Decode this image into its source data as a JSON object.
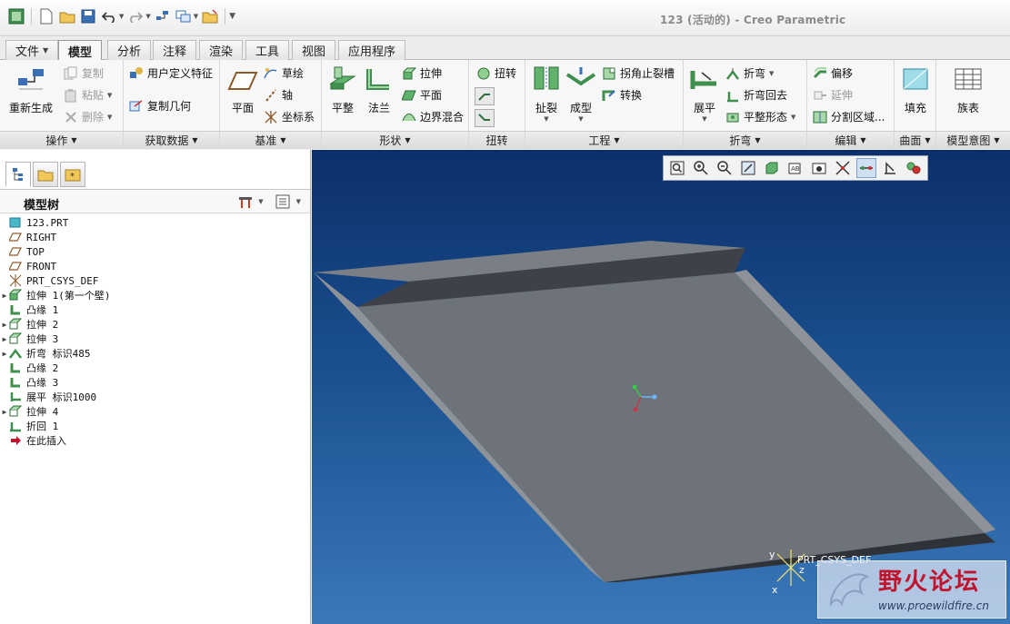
{
  "window": {
    "title": "123 (活动的) - Creo Parametric"
  },
  "quick_access": [
    {
      "name": "app-logo-icon"
    },
    {
      "name": "new-file-icon"
    },
    {
      "name": "open-folder-icon"
    },
    {
      "name": "save-icon"
    },
    {
      "name": "undo-icon"
    },
    {
      "name": "redo-icon"
    },
    {
      "name": "regenerate-icon"
    },
    {
      "name": "windows-icon"
    },
    {
      "name": "close-window-icon"
    }
  ],
  "tabs": [
    {
      "label": "文件",
      "has_menu": true
    },
    {
      "label": "模型",
      "active": true
    },
    {
      "label": "分析"
    },
    {
      "label": "注释"
    },
    {
      "label": "渲染"
    },
    {
      "label": "工具"
    },
    {
      "label": "视图"
    },
    {
      "label": "应用程序"
    }
  ],
  "ribbon": {
    "operations": {
      "group_label": "操作",
      "regenerate": "重新生成",
      "copy": "复制",
      "paste": "粘贴",
      "delete": "删除"
    },
    "get_data": {
      "group_label": "获取数据",
      "user_defined_feature": "用户定义特征",
      "copy_geometry": "复制几何"
    },
    "datum": {
      "group_label": "基准",
      "plane": "平面",
      "sketch": "草绘",
      "axis": "轴",
      "csys": "坐标系"
    },
    "shapes": {
      "group_label": "形状",
      "flat": "平整",
      "flange": "法兰",
      "extrude": "拉伸",
      "planar": "平面",
      "boundary_blend": "边界混合"
    },
    "twist": {
      "group_label": "扭转",
      "twist": "扭转"
    },
    "engineering": {
      "group_label": "工程",
      "rip": "扯裂",
      "form": "成型",
      "corner_relief": "拐角止裂槽",
      "convert": "转换"
    },
    "bends": {
      "group_label": "折弯",
      "unbend": "展平",
      "bend": "折弯",
      "bend_back": "折弯回去",
      "flatten_form": "平整形态"
    },
    "editing": {
      "group_label": "编辑",
      "offset": "偏移",
      "extend": "延伸",
      "split_area": "分割区域..."
    },
    "surfaces": {
      "group_label": "曲面",
      "fill": "填充"
    },
    "model_intent": {
      "group_label": "模型意图",
      "family_table": "族表"
    }
  },
  "left_panel": {
    "tree_title": "模型树",
    "tree": [
      {
        "label": "123.PRT",
        "icon": "part-icon",
        "expandable": false
      },
      {
        "label": "RIGHT",
        "icon": "datum-plane-icon",
        "expandable": false
      },
      {
        "label": "TOP",
        "icon": "datum-plane-icon",
        "expandable": false
      },
      {
        "label": "FRONT",
        "icon": "datum-plane-icon",
        "expandable": false
      },
      {
        "label": "PRT_CSYS_DEF",
        "icon": "csys-icon",
        "expandable": false
      },
      {
        "label": "拉伸 1(第一个壁)",
        "icon": "extrude-icon",
        "expandable": true
      },
      {
        "label": "凸缘 1",
        "icon": "flange-icon",
        "expandable": false
      },
      {
        "label": "拉伸 2",
        "icon": "extrude-cut-icon",
        "expandable": true
      },
      {
        "label": "拉伸 3",
        "icon": "extrude-cut-icon",
        "expandable": true
      },
      {
        "label": "折弯 标识485",
        "icon": "bend-icon",
        "expandable": true
      },
      {
        "label": "凸缘 2",
        "icon": "flange-icon",
        "expandable": false
      },
      {
        "label": "凸缘 3",
        "icon": "flange-icon",
        "expandable": false
      },
      {
        "label": "展平 标识1000",
        "icon": "unbend-icon",
        "expandable": false
      },
      {
        "label": "拉伸 4",
        "icon": "extrude-cut-icon",
        "expandable": true
      },
      {
        "label": "折回 1",
        "icon": "bend-back-icon",
        "expandable": false
      },
      {
        "label": "在此插入",
        "icon": "insert-here-icon",
        "expandable": false
      }
    ]
  },
  "viewport": {
    "csys_label": "PRT_CSYS_DEF",
    "axis_labels": {
      "y": "y",
      "z": "z",
      "x": "x"
    },
    "toolbar": [
      "refit-icon",
      "zoom-in-icon",
      "zoom-out-icon",
      "repaint-icon",
      "display-style-icon",
      "saved-orientations-icon",
      "view-manager-icon",
      "datum-display-icon",
      "csys-display-icon",
      "spin-center-icon",
      "annotation-display-icon",
      "appearance-icon"
    ],
    "watermark_text": "野火论坛",
    "watermark_url": "www.proewildfire.cn"
  },
  "colors": {
    "viewport_top": "#0c2f6a",
    "viewport_bottom": "#3a78ba",
    "model_gray": "#6e737a"
  }
}
